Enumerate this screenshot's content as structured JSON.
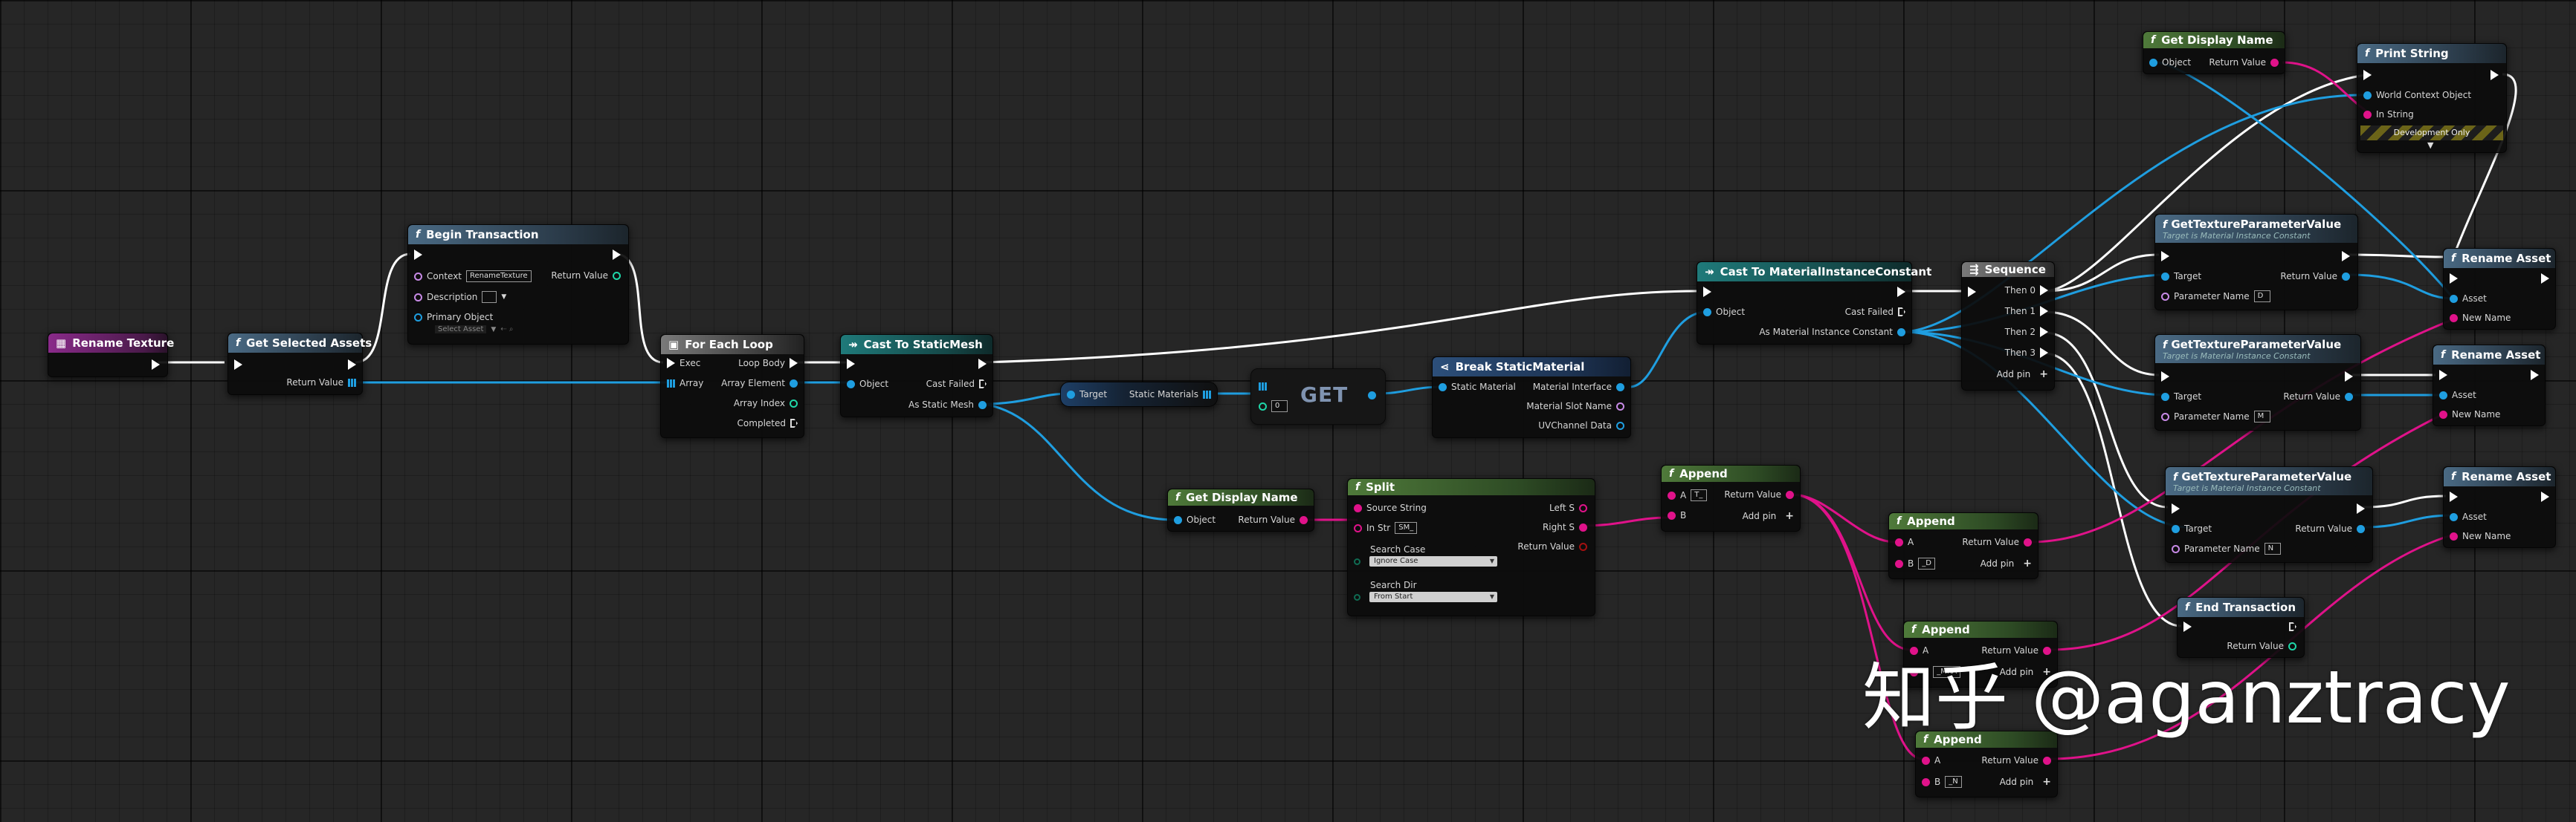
{
  "nodes": {
    "rename_texture": {
      "title": "Rename Texture"
    },
    "get_selected_assets": {
      "title": "Get Selected Assets",
      "return_value": "Return Value"
    },
    "begin_transaction": {
      "title": "Begin Transaction",
      "context_label": "Context",
      "context_value": "RenameTexture",
      "description_label": "Description",
      "primary_object_label": "Primary Object",
      "primary_object_value": "Select Asset",
      "return_value": "Return Value"
    },
    "for_each_loop": {
      "title": "For Each Loop",
      "exec": "Exec",
      "array": "Array",
      "loop_body": "Loop Body",
      "array_element": "Array Element",
      "array_index": "Array Index",
      "completed": "Completed"
    },
    "cast_static_mesh": {
      "title": "Cast To StaticMesh",
      "object": "Object",
      "cast_failed": "Cast Failed",
      "as_static_mesh": "As Static Mesh"
    },
    "static_materials": {
      "target": "Target",
      "static_materials": "Static Materials"
    },
    "get": {
      "title": "GET",
      "index_value": "0"
    },
    "break_static_material": {
      "title": "Break StaticMaterial",
      "static_material": "Static Material",
      "material_interface": "Material Interface",
      "material_slot_name": "Material Slot Name",
      "uv_channel_data": "UVChannel Data"
    },
    "cast_mic": {
      "title": "Cast To MaterialInstanceConstant",
      "object": "Object",
      "cast_failed": "Cast Failed",
      "as_mic": "As Material Instance Constant"
    },
    "sequence": {
      "title": "Sequence",
      "then0": "Then 0",
      "then1": "Then 1",
      "then2": "Then 2",
      "then3": "Then 3",
      "add_pin": "Add pin"
    },
    "get_display_name_top": {
      "title": "Get Display Name",
      "object": "Object",
      "return_value": "Return Value"
    },
    "print_string": {
      "title": "Print String",
      "world_context": "World Context Object",
      "in_string": "In String",
      "dev_only": "Development Only"
    },
    "gtpv1": {
      "title": "GetTextureParameterValue",
      "subtitle": "Target is Material Instance Constant",
      "target": "Target",
      "return_value": "Return Value",
      "param_name": "Parameter Name",
      "param_value": "D"
    },
    "gtpv2": {
      "title": "GetTextureParameterValue",
      "subtitle": "Target is Material Instance Constant",
      "target": "Target",
      "return_value": "Return Value",
      "param_name": "Parameter Name",
      "param_value": "M"
    },
    "gtpv3": {
      "title": "GetTextureParameterValue",
      "subtitle": "Target is Material Instance Constant",
      "target": "Target",
      "return_value": "Return Value",
      "param_name": "Parameter Name",
      "param_value": "N"
    },
    "rename1": {
      "title": "Rename Asset",
      "asset": "Asset",
      "new_name": "New Name"
    },
    "rename2": {
      "title": "Rename Asset",
      "asset": "Asset",
      "new_name": "New Name"
    },
    "rename3": {
      "title": "Rename Asset",
      "asset": "Asset",
      "new_name": "New Name"
    },
    "get_display_name_mid": {
      "title": "Get Display Name",
      "object": "Object",
      "return_value": "Return Value"
    },
    "split": {
      "title": "Split",
      "source_string": "Source String",
      "in_str": "In Str",
      "in_str_value": "SM_",
      "left_s": "Left S",
      "right_s": "Right S",
      "return_value": "Return Value",
      "search_case": "Search Case",
      "search_case_value": "Ignore Case",
      "search_dir": "Search Dir",
      "search_dir_value": "From Start"
    },
    "append1": {
      "title": "Append",
      "a": "A",
      "a_value": "T_",
      "b": "B",
      "return_value": "Return Value",
      "add_pin": "Add pin"
    },
    "append2": {
      "title": "Append",
      "a": "A",
      "b": "B",
      "b_value": "_D",
      "return_value": "Return Value",
      "add_pin": "Add pin"
    },
    "append3": {
      "title": "Append",
      "a": "A",
      "b": "B",
      "b_value": "_MRA",
      "return_value": "Return Value",
      "add_pin": "Add pin"
    },
    "append4": {
      "title": "Append",
      "a": "A",
      "b": "B",
      "b_value": "_N",
      "return_value": "Return Value",
      "add_pin": "Add pin"
    },
    "end_transaction": {
      "title": "End Transaction",
      "return_value": "Return Value"
    }
  },
  "watermark": "知乎 @aganztracy",
  "colors": {
    "exec": "#ffffff",
    "object": "#1f9ee0",
    "string": "#e0128a",
    "integer": "#1fd6a8",
    "name": "#c78ae6",
    "bool": "#a31010"
  }
}
